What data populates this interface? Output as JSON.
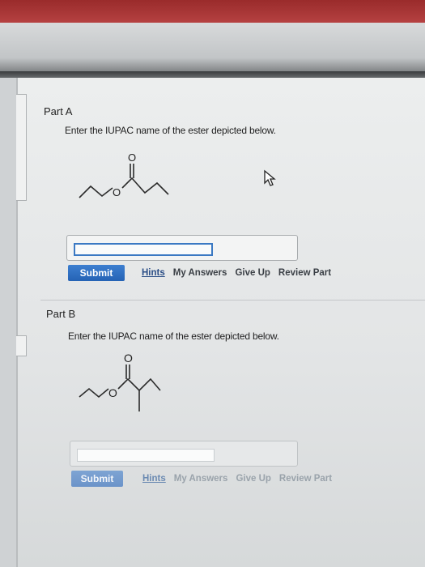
{
  "partA": {
    "title": "Part A",
    "prompt": "Enter the IUPAC name of the ester depicted below.",
    "answer_value": "",
    "atom_o_top": "O",
    "atom_o_ring": "O",
    "submit_label": "Submit",
    "links": [
      "Hints",
      "My Answers",
      "Give Up",
      "Review Part"
    ]
  },
  "partB": {
    "title": "Part B",
    "prompt": "Enter the IUPAC name of the ester depicted below.",
    "answer_value": "",
    "atom_o_top": "O",
    "atom_o_ring": "O",
    "submit_label": "Submit",
    "links": [
      "Hints",
      "My Answers",
      "Give Up",
      "Review Part"
    ]
  },
  "colors": {
    "accent": "#2f6fbf",
    "link": "#2b4e86",
    "header": "#a83434"
  },
  "icons": [
    "mouse-cursor-icon"
  ]
}
